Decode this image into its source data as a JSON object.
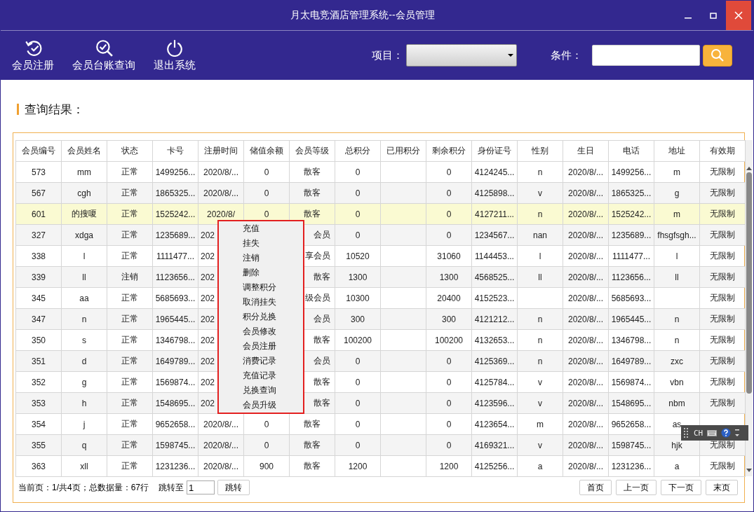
{
  "window": {
    "title": "月太电竞酒店管理系统--会员管理"
  },
  "toolbar": {
    "buttons": [
      {
        "label": "会员注册",
        "kind": "register"
      },
      {
        "label": "会员台账查询",
        "kind": "ledger"
      },
      {
        "label": "退出系统",
        "kind": "exit"
      }
    ],
    "project_label": "项目：",
    "condition_label": "条件："
  },
  "section_title": "查询结果：",
  "table": {
    "columns": [
      "会员编号",
      "会员姓名",
      "状态",
      "卡号",
      "注册时间",
      "储值余额",
      "会员等级",
      "总积分",
      "已用积分",
      "剩余积分",
      "身份证号",
      "性别",
      "生日",
      "电话",
      "地址",
      "有效期"
    ],
    "rows": [
      {
        "selected": false,
        "covered": false,
        "cells": {
          "0": "573",
          "1": "mm",
          "2": "正常",
          "3": "1499256...",
          "4": "2020/8/...",
          "5": "0",
          "6": "散客",
          "7": "0",
          "9": "0",
          "10": "4124245...",
          "11": "n",
          "12": "2020/8/...",
          "13": "1499256...",
          "14": "m",
          "15": "无限制"
        }
      },
      {
        "selected": false,
        "covered": false,
        "cells": {
          "0": "567",
          "1": "cgh",
          "2": "正常",
          "3": "1865325...",
          "4": "2020/8/...",
          "5": "0",
          "6": "散客",
          "7": "0",
          "9": "0",
          "10": "4125898...",
          "11": "v",
          "12": "2020/8/...",
          "13": "1865325...",
          "14": "g",
          "15": "无限制"
        }
      },
      {
        "selected": true,
        "covered": false,
        "cells": {
          "0": "601",
          "1": "的搜嗄",
          "2": "正常",
          "3": "1525242...",
          "4": "2020/8/",
          "5": "0",
          "6": "散客",
          "7": "0",
          "9": "0",
          "10": "4127211...",
          "11": "n",
          "12": "2020/8/...",
          "13": "1525242...",
          "14": "m",
          "15": "无限制"
        }
      },
      {
        "selected": false,
        "covered": true,
        "cells": {
          "0": "327",
          "1": "xdga",
          "2": "正常",
          "3": "1235689...",
          "4": "202",
          "6": "会员",
          "7": "0",
          "9": "0",
          "10": "1234567...",
          "11": "nan",
          "12": "2020/8/...",
          "13": "1235689...",
          "14": "fhsgfsgh...",
          "15": "无限制"
        }
      },
      {
        "selected": false,
        "covered": true,
        "cells": {
          "0": "338",
          "1": "l",
          "2": "正常",
          "3": "1111477...",
          "4": "202",
          "6": "享会员",
          "7": "10520",
          "9": "31060",
          "10": "1144453...",
          "11": "l",
          "12": "2020/8/...",
          "13": "1111477...",
          "14": "l",
          "15": "无限制"
        }
      },
      {
        "selected": false,
        "covered": true,
        "cells": {
          "0": "339",
          "1": "ll",
          "2": "注销",
          "3": "1123656...",
          "4": "202",
          "6": "散客",
          "7": "1300",
          "9": "1300",
          "10": "4568525...",
          "11": "ll",
          "12": "2020/8/...",
          "13": "1123656...",
          "14": "ll",
          "15": "无限制"
        }
      },
      {
        "selected": false,
        "covered": true,
        "cells": {
          "0": "345",
          "1": "aa",
          "2": "正常",
          "3": "5685693...",
          "4": "202",
          "6": "级会员",
          "7": "10300",
          "9": "20400",
          "10": "4152523...",
          "12": "2020/8/...",
          "13": "5685693...",
          "15": "无限制"
        }
      },
      {
        "selected": false,
        "covered": true,
        "cells": {
          "0": "347",
          "1": "n",
          "2": "正常",
          "3": "1965445...",
          "4": "202",
          "6": "会员",
          "7": "300",
          "9": "300",
          "10": "4121212...",
          "11": "n",
          "12": "2020/8/...",
          "13": "1965445...",
          "14": "n",
          "15": "无限制"
        }
      },
      {
        "selected": false,
        "covered": true,
        "cells": {
          "0": "350",
          "1": "s",
          "2": "正常",
          "3": "1346798...",
          "4": "202",
          "6": "散客",
          "7": "100200",
          "9": "100200",
          "10": "4132653...",
          "11": "n",
          "12": "2020/8/...",
          "13": "1346798...",
          "14": "n",
          "15": "无限制"
        }
      },
      {
        "selected": false,
        "covered": true,
        "cells": {
          "0": "351",
          "1": "d",
          "2": "正常",
          "3": "1649789...",
          "4": "202",
          "6": "会员",
          "7": "0",
          "9": "0",
          "10": "4125369...",
          "11": "n",
          "12": "2020/8/...",
          "13": "1649789...",
          "14": "zxc",
          "15": "无限制"
        }
      },
      {
        "selected": false,
        "covered": true,
        "cells": {
          "0": "352",
          "1": "g",
          "2": "正常",
          "3": "1569874...",
          "4": "202",
          "6": "散客",
          "7": "0",
          "9": "0",
          "10": "4125784...",
          "11": "v",
          "12": "2020/8/...",
          "13": "1569874...",
          "14": "vbn",
          "15": "无限制"
        }
      },
      {
        "selected": false,
        "covered": true,
        "cells": {
          "0": "353",
          "1": "h",
          "2": "正常",
          "3": "1548695...",
          "4": "202",
          "6": "散客",
          "7": "0",
          "9": "0",
          "10": "4123596...",
          "11": "v",
          "12": "2020/8/...",
          "13": "1548695...",
          "14": "nbm",
          "15": "无限制"
        }
      },
      {
        "selected": false,
        "covered": false,
        "cells": {
          "0": "354",
          "1": "j",
          "2": "正常",
          "3": "9652658...",
          "4": "2020/8/...",
          "5": "0",
          "6": "散客",
          "7": "0",
          "9": "0",
          "10": "4123654...",
          "11": "m",
          "12": "2020/8/...",
          "13": "9652658...",
          "14": "as"
        }
      },
      {
        "selected": false,
        "covered": false,
        "cells": {
          "0": "355",
          "1": "q",
          "2": "正常",
          "3": "1598745...",
          "4": "2020/8/...",
          "5": "0",
          "6": "散客",
          "7": "0",
          "9": "0",
          "10": "4169321...",
          "11": "v",
          "12": "2020/8/...",
          "13": "1598745...",
          "14": "hjk",
          "15": "无限制"
        }
      },
      {
        "selected": false,
        "covered": false,
        "cells": {
          "0": "363",
          "1": "xll",
          "2": "正常",
          "3": "1231236...",
          "4": "2020/8/...",
          "5": "900",
          "6": "散客",
          "7": "1200",
          "9": "1200",
          "10": "4125256...",
          "11": "a",
          "12": "2020/8/...",
          "13": "1231236...",
          "14": "a",
          "15": "无限制"
        }
      }
    ]
  },
  "context_menu": {
    "items": [
      "充值",
      "挂失",
      "注销",
      "删除",
      "调整积分",
      "取消挂失",
      "积分兑换",
      "会员修改",
      "会员注册",
      "消费记录",
      "充值记录",
      "兑换查询",
      "会员升级"
    ]
  },
  "pager": {
    "info": "当前页：1/共4页；总数据量：67行",
    "jump_label": "跳转至",
    "jump_value": "1",
    "jump_button": "跳转",
    "buttons": [
      "首页",
      "上一页",
      "下一页",
      "末页"
    ]
  },
  "ime_bar": {
    "label": "CH"
  }
}
